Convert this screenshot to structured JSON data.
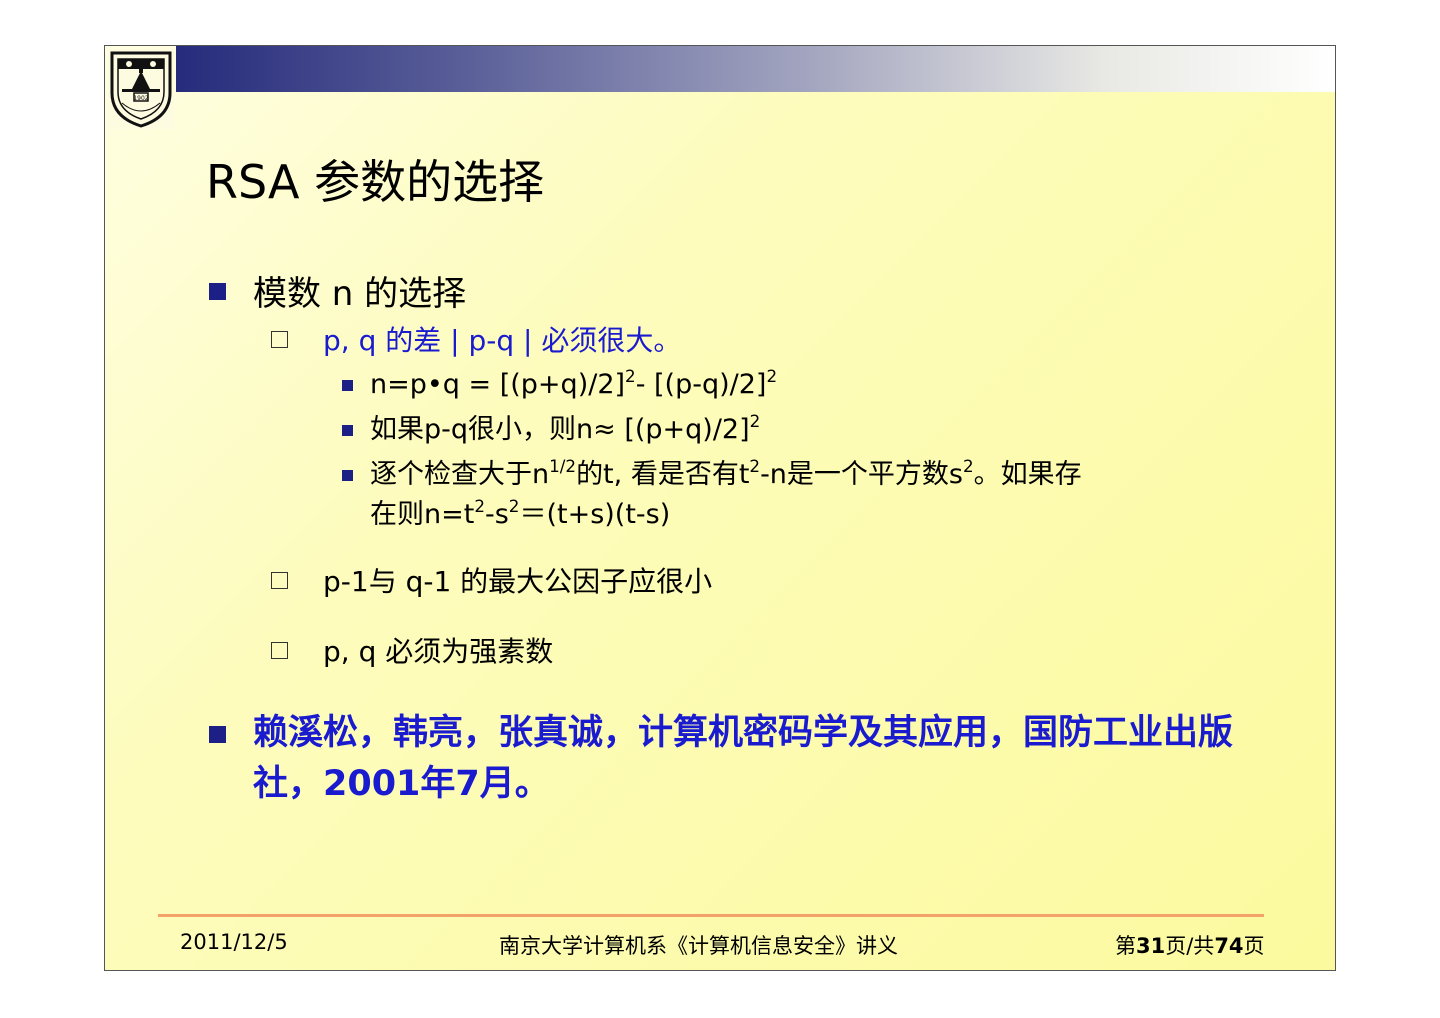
{
  "slide": {
    "title": "RSA 参数的选择",
    "bullet1": "模数 n 的选择",
    "sub1": "p, q 的差 | p-q | 必须很大。",
    "eq1": {
      "a": "n=p•q = [(p+q)/2]",
      "sup_a": "2",
      "b": "- [(p-q)/2]",
      "sup_b": "2"
    },
    "eq2": {
      "a": "如果p-q很小，则n≈ [(p+q)/2]",
      "sup_a": "2"
    },
    "eq3": {
      "a": "逐个检查大于n",
      "sup_a": "1/2",
      "b": "的t, 看是否有t",
      "sup_b": "2",
      "c": "-n是一个平方数s",
      "sup_c": "2",
      "d": "。如果存",
      "line2_a": "在则n=t",
      "sup_d": "2",
      "line2_b": "-s",
      "sup_e": "2",
      "line2_c": "＝(t+s)(t-s)"
    },
    "sub2": "p-1与 q-1 的最大公因子应很小",
    "sub3": "p, q 必须为强素数",
    "reference": "赖溪松，韩亮，张真诚，计算机密码学及其应用，国防工业出版社，2001年7月。"
  },
  "footer": {
    "date": "2011/12/5",
    "course": "南京大学计算机系《计算机信息安全》讲义",
    "page_prefix": "第",
    "page_current": "31",
    "page_mid": "页/共",
    "page_total": "74",
    "page_suffix": "页"
  },
  "logo": {
    "year": "1902",
    "text": "NANJING UNIVERSITY"
  },
  "colors": {
    "bullet": "#1c1f86",
    "accent_text": "#1a1acf",
    "footer_rule": "#f3a36a",
    "band_dark": "#262b7c"
  }
}
